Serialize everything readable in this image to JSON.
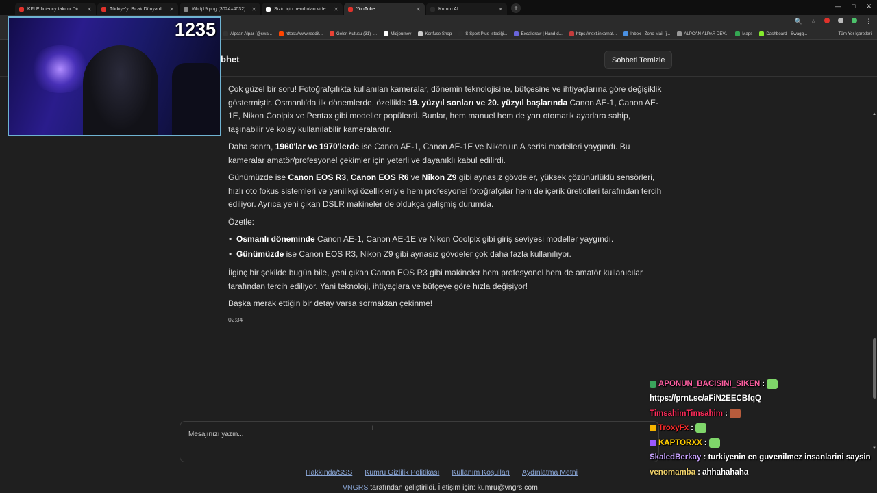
{
  "browser": {
    "tabs": [
      {
        "label": "KFLEfficiency takımı Dinamik S",
        "color": "#e0322b",
        "active": false
      },
      {
        "label": "Türkiye'yi Bırak Dünya da Yapar",
        "color": "#e0322b",
        "active": false
      },
      {
        "label": "t6hdj19.png (3024×4032)",
        "color": "#888888",
        "active": false
      },
      {
        "label": "Sizin için trend olan videoları iz",
        "color": "#ffffff",
        "active": false
      },
      {
        "label": "YouTube",
        "color": "#e0322b",
        "active": true
      },
      {
        "label": "Kumru AI",
        "color": "#2b2b2b",
        "active": false
      }
    ],
    "new_tab": "+",
    "bookmarks": [
      {
        "label": "Alpcan Alpar (@swa...",
        "color": "#333333"
      },
      {
        "label": "https://www.reddit...",
        "color": "#ff4500"
      },
      {
        "label": "Gelen Kutusu (31) -...",
        "color": "#e94235"
      },
      {
        "label": "Midjourney",
        "color": "#ffffff"
      },
      {
        "label": "Konfuse Shop",
        "color": "#cccccc"
      },
      {
        "label": "S Sport Plus-İstediği...",
        "color": "#2d2d2d"
      },
      {
        "label": "Excalidraw | Hand-d...",
        "color": "#6965db"
      },
      {
        "label": "https://next.inkarnat...",
        "color": "#c43c3c"
      },
      {
        "label": "Inbox - Zoho Mail (j...",
        "color": "#4a90e2"
      },
      {
        "label": "ALPCAN ALPAR DEV...",
        "color": "#999999"
      },
      {
        "label": "Maps",
        "color": "#34a853"
      },
      {
        "label": "Dashboard - Swagg...",
        "color": "#85ea2d"
      }
    ],
    "all_bookmarks": "Tüm Yer İşaretleri"
  },
  "webcam": {
    "counter": "1235"
  },
  "header": {
    "title": "bhet",
    "clear_button": "Sohbeti Temizle"
  },
  "message": {
    "p1_a": "Çok güzel bir soru! Fotoğrafçılıkta kullanılan kameralar, dönemin teknolojisine, bütçesine ve ihtiyaçlarına göre değişiklik göstermiştir. Osmanlı'da ilk dönemlerde, özellikle ",
    "p1_b": "19. yüzyıl sonları ve 20. yüzyıl başlarında",
    "p1_c": " Canon AE-1, Canon AE-1E, Nikon Coolpix ve Pentax gibi modeller popülerdi. Bunlar, hem manuel hem de yarı otomatik ayarlara sahip, taşınabilir ve kolay kullanılabilir kameralardır.",
    "p2_a": "Daha sonra, ",
    "p2_b": "1960'lar ve 1970'lerde",
    "p2_c": " ise Canon AE-1, Canon AE-1E ve Nikon'un A serisi modelleri yaygındı. Bu kameralar amatör/profesyonel çekimler için yeterli ve dayanıklı kabul edilirdi.",
    "p3_a": "Günümüzde ise ",
    "p3_b": "Canon EOS R3",
    "p3_c": ", ",
    "p3_d": "Canon EOS R6",
    "p3_e": " ve ",
    "p3_f": "Nikon Z9",
    "p3_g": " gibi aynasız gövdeler, yüksek çözünürlüklü sensörleri, hızlı oto fokus sistemleri ve yenilikçi özellikleriyle hem profesyonel fotoğrafçılar hem de içerik üreticileri tarafından tercih ediliyor. Ayrıca yeni çıkan DSLR makineler de oldukça gelişmiş durumda.",
    "p4": "Özetle:",
    "li1_b": "Osmanlı döneminde",
    "li1_c": " Canon AE-1, Canon AE-1E ve Nikon Coolpix gibi giriş seviyesi modeller yaygındı.",
    "li2_b": "Günümüzde",
    "li2_c": " ise Canon EOS R3, Nikon Z9 gibi aynasız gövdeler çok daha fazla kullanılıyor.",
    "p5": "İlginç bir şekilde bugün bile, yeni çıkan Canon EOS R3 gibi makineler hem profesyonel hem de amatör kullanıcılar tarafından tercih ediliyor. Yani teknoloji, ihtiyaçlara ve bütçeye göre hızla değişiyor!",
    "p6": "Başka merak ettiğin bir detay varsa sormaktan çekinme!",
    "time": "02:34"
  },
  "input": {
    "placeholder": "Mesajınızı yazın..."
  },
  "footer": {
    "links": [
      "Hakkında/SSS",
      "Kumru Gizlilik Politikası",
      "Kullanım Koşulları",
      "Aydınlatma Metni"
    ],
    "brand": "VNGRS",
    "note": " tarafından geliştirildi. İletişim için: kumru@vngrs.com"
  },
  "stream_chat": [
    {
      "user": "APONUN_BACISINI_SIKEN",
      "user_color": "#ff5fa2",
      "text": " :",
      "badge_color": "#3aa35c"
    },
    {
      "user": "",
      "user_color": "#ffffff",
      "text": "https://prnt.sc/aFiN2EECBfqQ",
      "badge_color": ""
    },
    {
      "user": "TimsahimTimsahim",
      "user_color": "#ff2b5a",
      "text": " :",
      "badge_color": ""
    },
    {
      "user": "TroxyFx",
      "user_color": "#ff2b2b",
      "text": " :",
      "badge_color": "#f5b300"
    },
    {
      "user": "KAPTORXX",
      "user_color": "#ffcc00",
      "text": " :",
      "badge_color": "#9b59ff"
    },
    {
      "user": "SkaledBerkay",
      "user_color": "#c8a2ff",
      "text": " : turkiyenin en guvenilmez insanlarini saysin",
      "badge_color": ""
    },
    {
      "user": "venomamba",
      "user_color": "#f2d36b",
      "text": " : ahhahahaha",
      "badge_color": ""
    }
  ]
}
